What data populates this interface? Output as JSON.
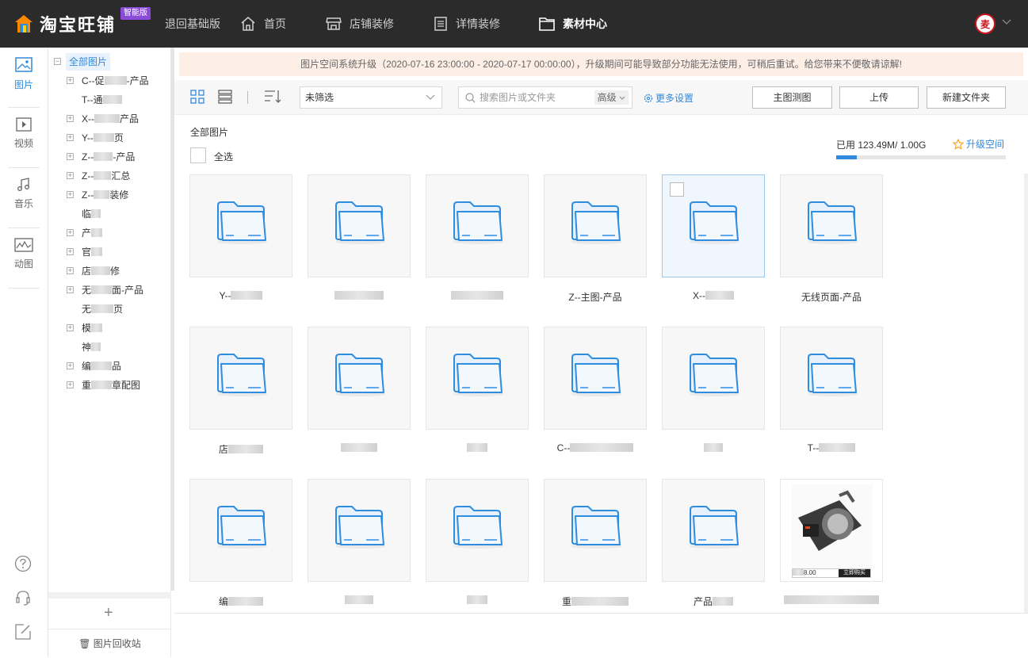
{
  "header": {
    "brand": "淘宝旺铺",
    "badge": "智能版",
    "nav": [
      {
        "label": "退回基础版",
        "icon": "none"
      },
      {
        "label": "首页",
        "icon": "home-icon"
      },
      {
        "label": "店铺装修",
        "icon": "store-icon"
      },
      {
        "label": "详情装修",
        "icon": "document-icon"
      },
      {
        "label": "素材中心",
        "icon": "folder-icon"
      }
    ],
    "avatar_text": "麦"
  },
  "rail": {
    "items": [
      {
        "label": "图片",
        "icon": "image-icon"
      },
      {
        "label": "视频",
        "icon": "video-icon"
      },
      {
        "label": "音乐",
        "icon": "music-icon"
      },
      {
        "label": "动图",
        "icon": "animation-icon"
      }
    ]
  },
  "tree": {
    "root": "全部图片",
    "nodes": [
      {
        "prefix": "C--促",
        "suffix": "-产品",
        "expandable": true
      },
      {
        "prefix": "T--通",
        "suffix": "",
        "expandable": false
      },
      {
        "prefix": "X--",
        "suffix": "产品",
        "expandable": true
      },
      {
        "prefix": "Y--",
        "suffix": "页",
        "expandable": true
      },
      {
        "prefix": "Z--",
        "suffix": "-产品",
        "expandable": true
      },
      {
        "prefix": "Z--",
        "suffix": "汇总",
        "expandable": true
      },
      {
        "prefix": "Z--",
        "suffix": "装修",
        "expandable": true
      },
      {
        "prefix": "临",
        "suffix": "",
        "expandable": false
      },
      {
        "prefix": "产",
        "suffix": "",
        "expandable": true
      },
      {
        "prefix": "官",
        "suffix": "",
        "expandable": true
      },
      {
        "prefix": "店",
        "suffix": "修",
        "expandable": true
      },
      {
        "prefix": "无",
        "suffix": "面-产品",
        "expandable": true
      },
      {
        "prefix": "无",
        "suffix": "页",
        "expandable": false
      },
      {
        "prefix": "模",
        "suffix": "",
        "expandable": true
      },
      {
        "prefix": "神",
        "suffix": "",
        "expandable": false
      },
      {
        "prefix": "编",
        "suffix": "品",
        "expandable": true
      },
      {
        "prefix": "重",
        "suffix": "章配图",
        "expandable": true
      }
    ],
    "recycle_label": "图片回收站"
  },
  "notice": "图片空间系统升级（2020-07-16 23:00:00 - 2020-07-17 00:00:00），升级期间可能导致部分功能无法使用，可稍后重试。给您带来不便敬请谅解!",
  "toolbar": {
    "filter_value": "未筛选",
    "search_placeholder": "搜索图片或文件夹",
    "advanced_label": "高级",
    "more_settings": "更多设置",
    "btn_main_test": "主图测图",
    "btn_upload": "上传",
    "btn_new_folder": "新建文件夹"
  },
  "breadcrumb": "全部图片",
  "select_all": "全选",
  "quota": {
    "text": "已用 123.49M/ 1.00G",
    "used_fraction": 0.12,
    "upgrade_label": "升级空间"
  },
  "grid": {
    "items": [
      {
        "type": "folder",
        "label": "Y--",
        "blurred": true
      },
      {
        "type": "folder",
        "label": "",
        "blurred": true
      },
      {
        "type": "folder",
        "label": "",
        "blurred": true
      },
      {
        "type": "folder",
        "label": "Z--主图-产品",
        "blurred": false
      },
      {
        "type": "folder",
        "label": "X--",
        "blurred": true,
        "hover": true
      },
      {
        "type": "folder",
        "label": "无线页面-产品",
        "blurred": false
      },
      {
        "type": "folder",
        "label": "店",
        "blurred": true
      },
      {
        "type": "folder",
        "label": "",
        "blurred": true
      },
      {
        "type": "folder",
        "label": "",
        "blurred": true
      },
      {
        "type": "folder",
        "label": "C--",
        "blurred": true
      },
      {
        "type": "folder",
        "label": "",
        "blurred": true
      },
      {
        "type": "folder",
        "label": "T--",
        "blurred": true
      },
      {
        "type": "folder",
        "label": "编",
        "blurred": true
      },
      {
        "type": "folder",
        "label": "",
        "blurred": true
      },
      {
        "type": "folder",
        "label": "",
        "blurred": true
      },
      {
        "type": "folder",
        "label": "重",
        "blurred": true
      },
      {
        "type": "folder",
        "label": "产品",
        "blurred": true
      },
      {
        "type": "image",
        "label": "",
        "blurred": true,
        "price": "8.00",
        "buy_label": "立即购买"
      }
    ]
  },
  "colors": {
    "accent": "#3089dc",
    "topbar": "#2b2b2b",
    "notice_bg": "#fdeee6",
    "folder": "#2f8de0"
  }
}
